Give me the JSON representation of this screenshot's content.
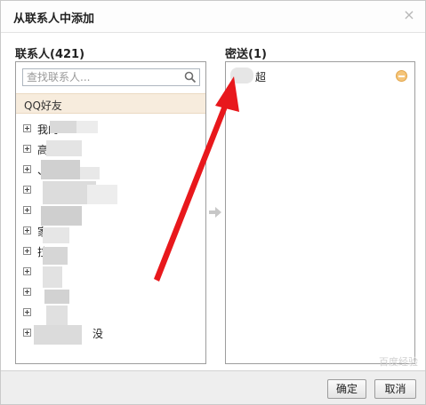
{
  "dialog": {
    "title": "从联系人中添加",
    "close_label": "×"
  },
  "left": {
    "title": "联系人(421)",
    "search_placeholder": "查找联系人...",
    "group_label": "QQ好友",
    "tree_items": [
      {
        "label": "我的"
      },
      {
        "label": "高"
      },
      {
        "label": "、"
      },
      {
        "label": ""
      },
      {
        "label": ""
      },
      {
        "label": "家"
      },
      {
        "label": "拉"
      },
      {
        "label": ""
      },
      {
        "label": ""
      },
      {
        "label": ""
      },
      {
        "label": "没"
      }
    ]
  },
  "right": {
    "title": "密送(1)",
    "recipient_name": "超"
  },
  "footer": {
    "ok_label": "确定",
    "cancel_label": "取消"
  },
  "watermark": "百度经验",
  "colors": {
    "group_header_bg": "#f7ecdd",
    "remove_icon": "#f5c57a",
    "annotation_arrow": "#e8181c"
  }
}
